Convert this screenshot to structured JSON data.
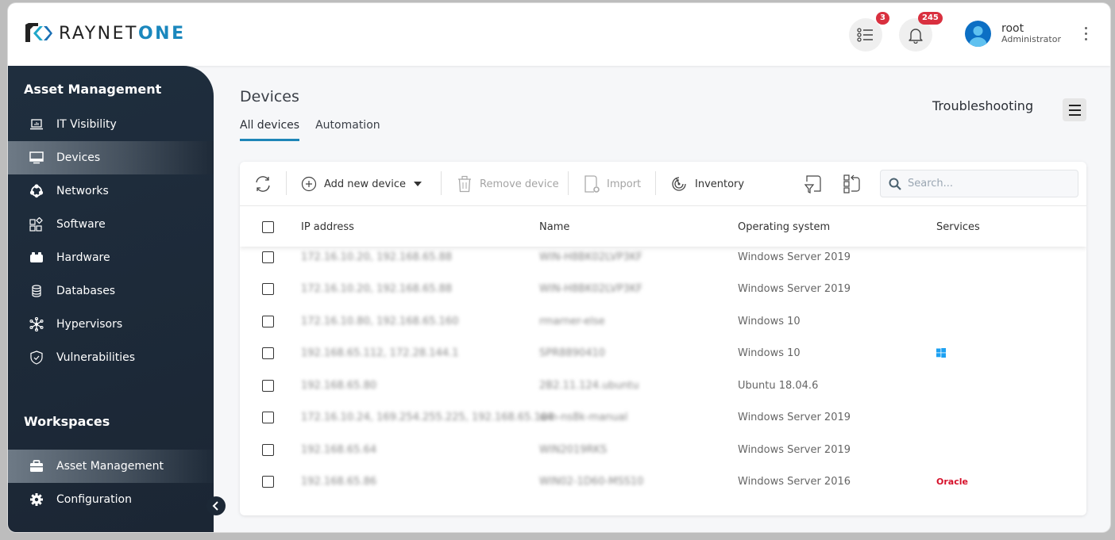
{
  "app": {
    "brand_prefix": "RAYNET",
    "brand_suffix": "ONE"
  },
  "header": {
    "tasks_badge": "3",
    "notifications_badge": "245",
    "user_name": "root",
    "user_role": "Administrator",
    "brand_color": "#1a87bd",
    "badge_color": "#d9303f"
  },
  "sidebar": {
    "section_title": "Asset Management",
    "items": [
      {
        "label": "IT Visibility",
        "icon": "laptop-chart-icon"
      },
      {
        "label": "Devices",
        "icon": "monitor-icon",
        "active": true
      },
      {
        "label": "Networks",
        "icon": "network-icon"
      },
      {
        "label": "Software",
        "icon": "software-icon"
      },
      {
        "label": "Hardware",
        "icon": "hardware-icon"
      },
      {
        "label": "Databases",
        "icon": "database-icon"
      },
      {
        "label": "Hypervisors",
        "icon": "hypervisor-icon"
      },
      {
        "label": "Vulnerabilities",
        "icon": "shield-check-icon"
      }
    ],
    "workspaces_title": "Workspaces",
    "workspaces": [
      {
        "label": "Asset Management",
        "icon": "briefcase-icon",
        "active": true
      },
      {
        "label": "Configuration",
        "icon": "gear-icon"
      }
    ]
  },
  "page": {
    "title": "Devices",
    "tabs": [
      {
        "label": "All devices",
        "active": true
      },
      {
        "label": "Automation"
      }
    ],
    "troubleshooting_label": "Troubleshooting"
  },
  "toolbar": {
    "add_label": "Add new device",
    "remove_label": "Remove device",
    "import_label": "Import",
    "inventory_label": "Inventory",
    "search_placeholder": "Search..."
  },
  "table": {
    "columns": [
      "IP address",
      "Name",
      "Operating system",
      "Services"
    ],
    "rows": [
      {
        "ip": "172.16.10.20, 192.168.65.88",
        "name": "WIN-H8BK02LVP3KF",
        "os": "Windows Server 2019",
        "service": ""
      },
      {
        "ip": "172.16.10.20, 192.168.65.88",
        "name": "WIN-H8BK02LVP3KF",
        "os": "Windows Server 2019",
        "service": ""
      },
      {
        "ip": "172.16.10.80, 192.168.65.160",
        "name": "rmarner-else",
        "os": "Windows 10",
        "service": ""
      },
      {
        "ip": "192.168.65.112, 172.28.144.1",
        "name": "SPR8890410",
        "os": "Windows 10",
        "service": "windows"
      },
      {
        "ip": "192.168.65.80",
        "name": "2B2.11.124.ubuntu",
        "os": "Ubuntu 18.04.6",
        "service": ""
      },
      {
        "ip": "172.16.10.24, 169.254.255.225, 192.168.65.104",
        "name": "win-ns8k-manual",
        "os": "Windows Server 2019",
        "service": ""
      },
      {
        "ip": "192.168.65.64",
        "name": "WIN2019RKS",
        "os": "Windows Server 2019",
        "service": ""
      },
      {
        "ip": "192.168.65.86",
        "name": "WIN02-1D60-MSS10",
        "os": "Windows Server 2016",
        "service": "Oracle"
      }
    ]
  }
}
